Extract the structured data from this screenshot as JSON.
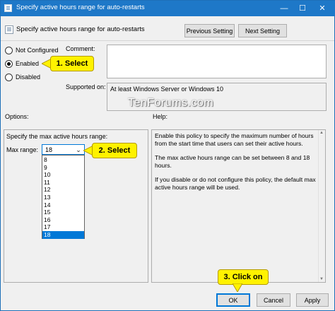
{
  "window": {
    "title": "Specify active hours range for auto-restarts",
    "controls": {
      "minimize": "—",
      "maximize": "☐",
      "close": "✕"
    }
  },
  "header": {
    "policy_name": "Specify active hours range for auto-restarts",
    "prev_button": "Previous Setting",
    "next_button": "Next Setting"
  },
  "state": {
    "options": [
      {
        "label": "Not Configured",
        "selected": false
      },
      {
        "label": "Enabled",
        "selected": true
      },
      {
        "label": "Disabled",
        "selected": false
      }
    ]
  },
  "comment": {
    "label": "Comment:",
    "value": ""
  },
  "supported": {
    "label": "Supported on:",
    "value": "At least Windows Server or Windows 10"
  },
  "watermark": "TenForums.com",
  "options_panel": {
    "heading": "Options:",
    "description": "Specify the max active hours range:",
    "max_range_label": "Max range:",
    "selected_value": "18",
    "list": [
      "8",
      "9",
      "10",
      "11",
      "12",
      "13",
      "14",
      "15",
      "16",
      "17",
      "18"
    ]
  },
  "help_panel": {
    "heading": "Help:",
    "paragraphs": [
      "Enable this policy to specify the maximum number of hours from the start time that users can set their active hours.",
      "The max active hours range can be set between 8 and 18 hours.",
      "If you disable or do not configure this policy, the default max active hours range will be used."
    ]
  },
  "footer": {
    "ok": "OK",
    "cancel": "Cancel",
    "apply": "Apply"
  },
  "callouts": {
    "step1": "1. Select",
    "step2": "2. Select",
    "step3": "3. Click on",
    "color": "#fff200"
  },
  "colors": {
    "titlebar": "#1e78c8",
    "accent": "#0078d7"
  }
}
